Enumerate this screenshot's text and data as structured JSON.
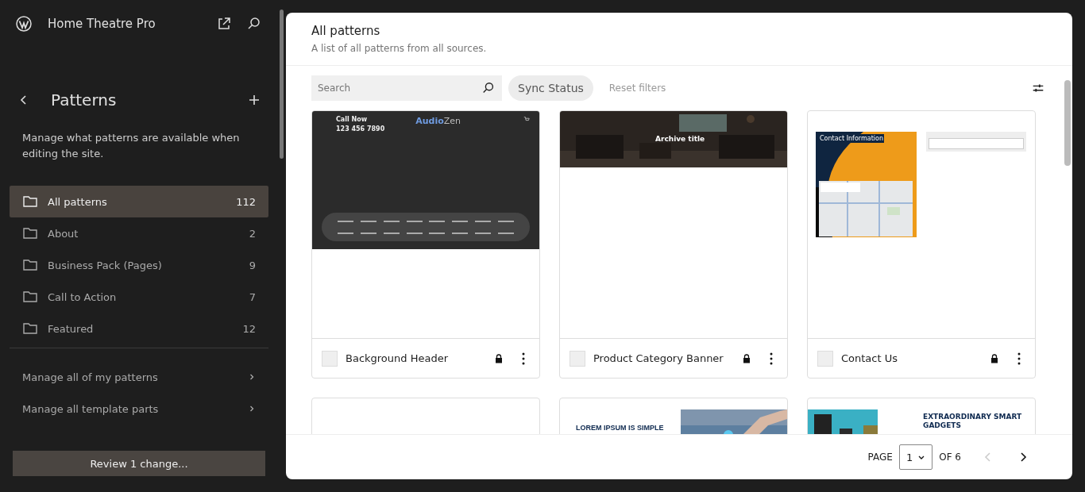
{
  "site": {
    "title": "Home Theatre Pro"
  },
  "sidebar": {
    "title": "Patterns",
    "description": "Manage what patterns are available when editing the site.",
    "categories": [
      {
        "label": "All patterns",
        "count": "112",
        "selected": true
      },
      {
        "label": "About",
        "count": "2",
        "selected": false
      },
      {
        "label": "Business Pack (Pages)",
        "count": "9",
        "selected": false
      },
      {
        "label": "Call to Action",
        "count": "7",
        "selected": false
      },
      {
        "label": "Featured",
        "count": "12",
        "selected": false
      }
    ],
    "links": [
      "Manage all of my patterns",
      "Manage all template parts"
    ],
    "review_button": "Review 1 change..."
  },
  "main": {
    "title": "All patterns",
    "subtitle": "A list of all patterns from all sources.",
    "search": {
      "placeholder": "Search"
    },
    "filters": [
      {
        "label": "Sync Status",
        "disabled": false
      },
      {
        "label": "Reset filters",
        "disabled": true
      }
    ],
    "patterns": [
      {
        "kind": "header",
        "title": "Background Header",
        "locked": true,
        "checked": false,
        "texts": [
          "Call Now",
          "123 456 7890",
          "Audio",
          "Zen"
        ]
      },
      {
        "kind": "archive",
        "title": "Product Category Banner",
        "locked": true,
        "checked": false,
        "texts": [
          "Archive title"
        ]
      },
      {
        "kind": "contact",
        "title": "Contact Us",
        "locked": true,
        "checked": false,
        "texts": [
          "Contact Information"
        ]
      },
      {
        "kind": "blank"
      },
      {
        "kind": "text-image",
        "texts": [
          "LOREM IPSUM IS SIMPLE"
        ]
      },
      {
        "kind": "image-text",
        "texts": [
          "EXTRAORDINARY SMART GADGETS"
        ]
      }
    ],
    "pagination": {
      "label": "PAGE",
      "value": "1",
      "of": "OF 6",
      "previous_disabled": true,
      "next_disabled": false
    }
  }
}
